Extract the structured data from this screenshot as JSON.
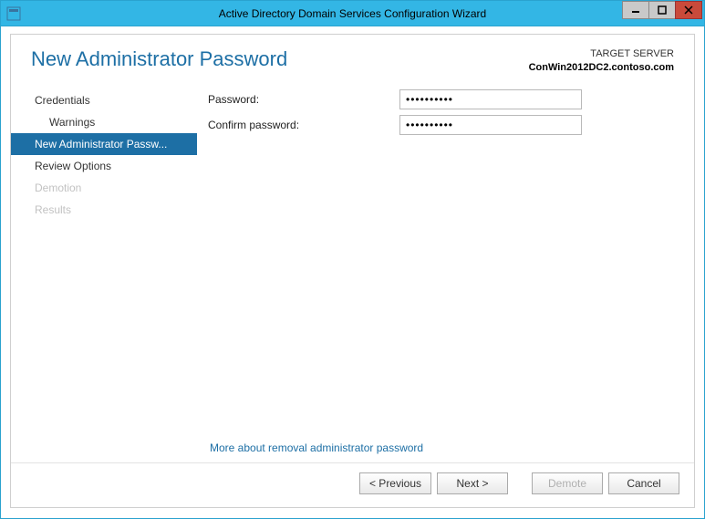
{
  "window": {
    "title": "Active Directory Domain Services Configuration Wizard"
  },
  "header": {
    "page_title": "New Administrator Password",
    "target_label": "TARGET SERVER",
    "target_host": "ConWin2012DC2.contoso.com"
  },
  "sidebar": {
    "items": [
      {
        "label": "Credentials",
        "child": false,
        "selected": false,
        "disabled": false
      },
      {
        "label": "Warnings",
        "child": true,
        "selected": false,
        "disabled": false
      },
      {
        "label": "New Administrator Passw...",
        "child": false,
        "selected": true,
        "disabled": false
      },
      {
        "label": "Review Options",
        "child": false,
        "selected": false,
        "disabled": false
      },
      {
        "label": "Demotion",
        "child": false,
        "selected": false,
        "disabled": true
      },
      {
        "label": "Results",
        "child": false,
        "selected": false,
        "disabled": true
      }
    ]
  },
  "form": {
    "password_label": "Password:",
    "confirm_label": "Confirm password:",
    "password_value": "••••••••••",
    "confirm_value": "••••••••••"
  },
  "help_link": "More about removal administrator password",
  "buttons": {
    "previous": "< Previous",
    "next": "Next >",
    "demote": "Demote",
    "cancel": "Cancel"
  }
}
